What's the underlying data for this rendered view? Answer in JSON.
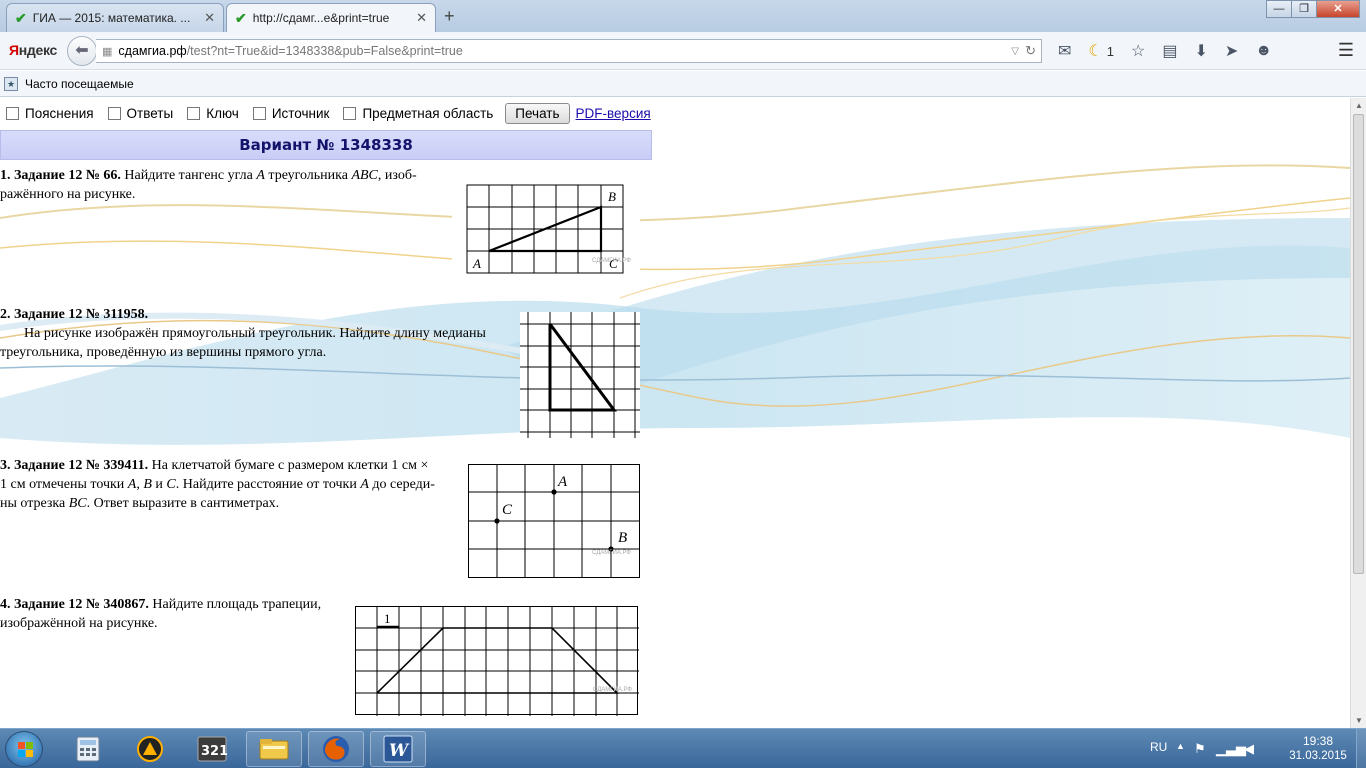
{
  "browser": {
    "tabs": [
      {
        "title": "ГИА — 2015: математика. ..."
      },
      {
        "title": "http://сдамг...e&print=true"
      }
    ],
    "new_tab_symbol": "+",
    "window_buttons": {
      "minimize": "—",
      "restore": "❐",
      "close": "✕"
    },
    "brand_first_letter": "Я",
    "brand_rest": "ндекс",
    "url_domain": "сдамгиа.рф",
    "url_path": "/test?nt=True&id=1348338&pub=False&print=true",
    "weather_count": "1",
    "bookmarks_label": "Часто посещаемые"
  },
  "page": {
    "checkboxes": [
      "Пояснения",
      "Ответы",
      "Ключ",
      "Источник",
      "Предметная область"
    ],
    "print_button": "Печать",
    "pdf_link": "PDF-версия",
    "variant_title": "Вариант № 1348338",
    "tasks": [
      {
        "header": "1. Задание 12 № 66.",
        "text_1": " Найдите тангенс угла ",
        "italic_1": "A",
        "text_2": " треугольника ",
        "italic_2": "ABC",
        "text_3": ", изоб-",
        "line_2": "ражённого на рисунке.",
        "labels": {
          "a": "A",
          "b": "B",
          "c": "C",
          "watermark": "СДАМГИА.РФ"
        }
      },
      {
        "header": "2. Задание 12 № 311958.",
        "line_1": "На рисунке изображён прямоугольный треугольник. Найдите длину медианы",
        "line_2": "треугольника, проведённую из вершины прямого угла."
      },
      {
        "header": "3. Задание 12 № 339411.",
        "text_1": " На клетчатой бумаге с размером клетки 1 см ×",
        "line_2_a": "1 см отмечены точки ",
        "line_2_i1": "A",
        "line_2_b": ", ",
        "line_2_i2": "B",
        "line_2_c": " и ",
        "line_2_i3": "C",
        "line_2_d": ". Найдите расстояние от точки ",
        "line_2_i4": "A",
        "line_2_e": " до середи-",
        "line_3_a": "ны отрезка ",
        "line_3_i": "BC",
        "line_3_b": ". Ответ выразите в сантиметрах.",
        "labels": {
          "a": "A",
          "b": "B",
          "c": "C",
          "watermark": "СДАМГИА.РФ"
        }
      },
      {
        "header": "4. Задание 12 № 340867.",
        "text_1": " Найдите площадь трапеции,",
        "line_2": "изображённой на рисунке.",
        "labels": {
          "unit": "1",
          "watermark": "СДАМГИА.РФ"
        }
      }
    ]
  },
  "taskbar": {
    "lang": "RU",
    "time": "19:38",
    "date": "31.03.2015"
  }
}
